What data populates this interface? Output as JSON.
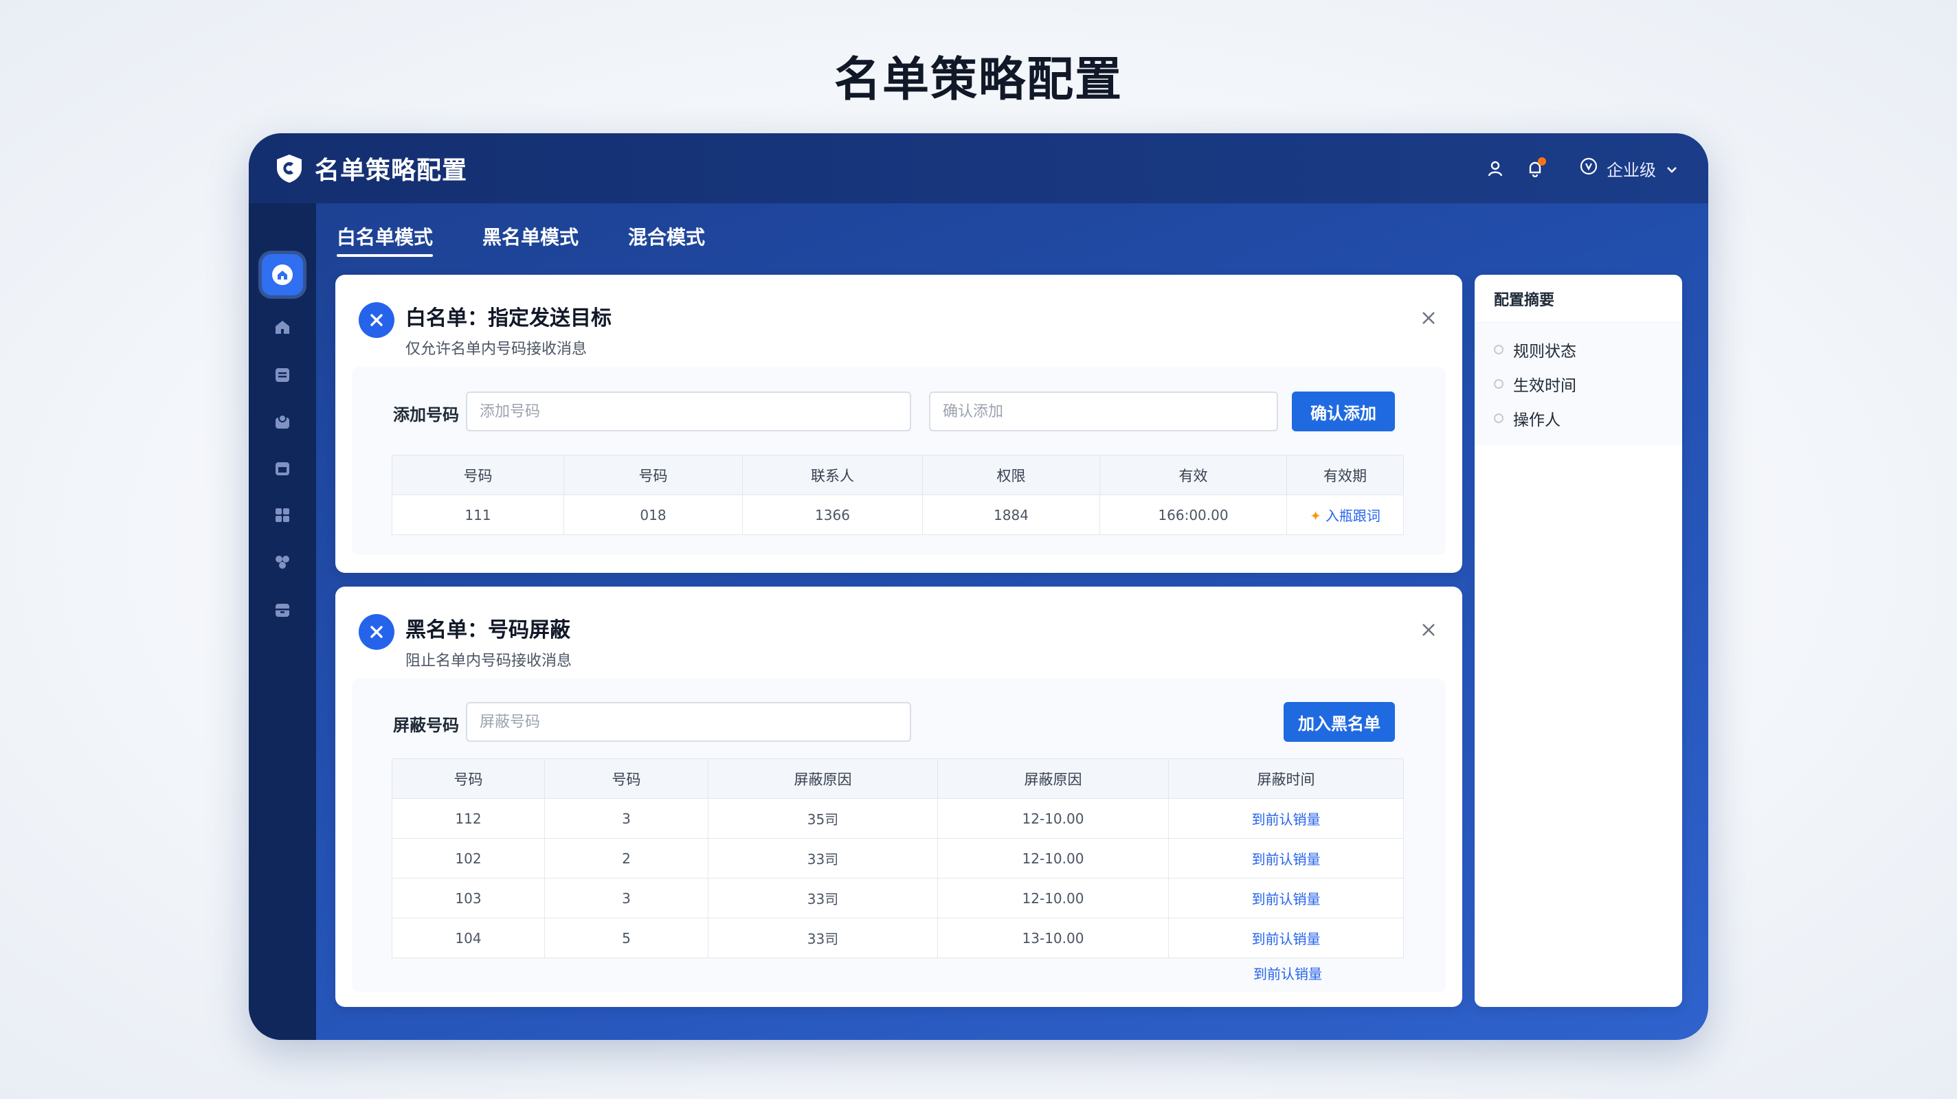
{
  "page": {
    "title": "名单策略配置"
  },
  "app": {
    "title": "名单策略配置",
    "account_label": "企业级"
  },
  "sidebar": {
    "items": [
      {
        "name": "home-active-icon"
      },
      {
        "name": "home-icon"
      },
      {
        "name": "list-icon"
      },
      {
        "name": "contacts-icon"
      },
      {
        "name": "calendar-icon"
      },
      {
        "name": "apps-grid-icon"
      },
      {
        "name": "settings-icon"
      },
      {
        "name": "archive-icon"
      }
    ]
  },
  "tabs": [
    {
      "label": "白名单模式",
      "active": true
    },
    {
      "label": "黑名单模式",
      "active": false
    },
    {
      "label": "混合模式",
      "active": false
    }
  ],
  "whitelist": {
    "title": "白名单：指定发送目标",
    "subtitle": "仅允许名单内号码接收消息",
    "form_label": "添加号码",
    "input_placeholder": "添加号码",
    "confirm_placeholder": "确认添加",
    "button_label": "确认添加",
    "columns": [
      "号码",
      "号码",
      "联系人",
      "权限",
      "有效",
      "有效期"
    ],
    "rows": [
      [
        "111",
        "018",
        "1366",
        "1884",
        "166:00.00",
        "入瓶跟词"
      ]
    ]
  },
  "blacklist": {
    "title": "黑名单：号码屏蔽",
    "subtitle": "阻止名单内号码接收消息",
    "form_label": "屏蔽号码",
    "input_placeholder": "屏蔽号码",
    "button_label": "加入黑名单",
    "columns": [
      "号码",
      "号码",
      "屏蔽原因",
      "屏蔽原因",
      "屏蔽时间"
    ],
    "rows": [
      [
        "112",
        "3",
        "35司",
        "12-10.00",
        "到前认销量"
      ],
      [
        "102",
        "2",
        "33司",
        "12-10.00",
        "到前认销量"
      ],
      [
        "103",
        "3",
        "33司",
        "12-10.00",
        "到前认销量"
      ],
      [
        "104",
        "5",
        "33司",
        "13-10.00",
        "到前认销量"
      ]
    ],
    "extra_link": "到前认销量"
  },
  "summary": {
    "title": "配置摘要",
    "items": [
      "规则状态",
      "生效时间",
      "操作人"
    ]
  },
  "colors": {
    "accent": "#1f6ae0",
    "nav_dark": "#10275c",
    "header": "#17367d",
    "notify": "#f97316"
  }
}
